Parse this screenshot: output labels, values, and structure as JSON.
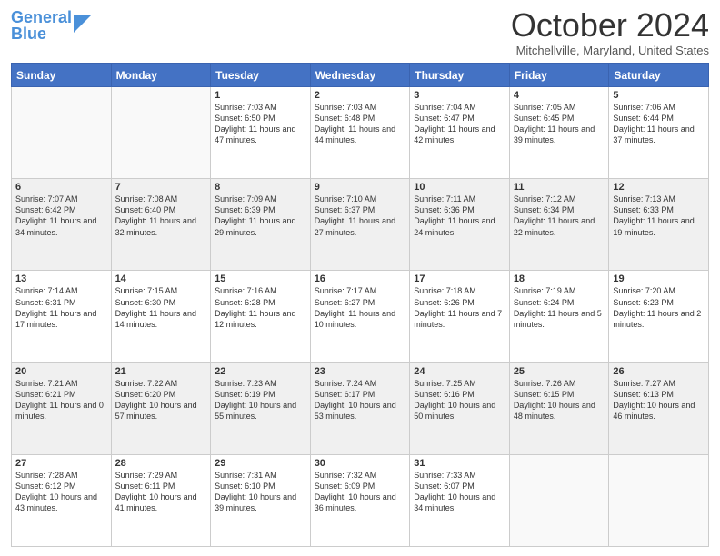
{
  "logo": {
    "line1": "General",
    "line2": "Blue"
  },
  "title": "October 2024",
  "location": "Mitchellville, Maryland, United States",
  "days_header": [
    "Sunday",
    "Monday",
    "Tuesday",
    "Wednesday",
    "Thursday",
    "Friday",
    "Saturday"
  ],
  "weeks": [
    [
      {
        "day": "",
        "info": ""
      },
      {
        "day": "",
        "info": ""
      },
      {
        "day": "1",
        "info": "Sunrise: 7:03 AM\nSunset: 6:50 PM\nDaylight: 11 hours and 47 minutes."
      },
      {
        "day": "2",
        "info": "Sunrise: 7:03 AM\nSunset: 6:48 PM\nDaylight: 11 hours and 44 minutes."
      },
      {
        "day": "3",
        "info": "Sunrise: 7:04 AM\nSunset: 6:47 PM\nDaylight: 11 hours and 42 minutes."
      },
      {
        "day": "4",
        "info": "Sunrise: 7:05 AM\nSunset: 6:45 PM\nDaylight: 11 hours and 39 minutes."
      },
      {
        "day": "5",
        "info": "Sunrise: 7:06 AM\nSunset: 6:44 PM\nDaylight: 11 hours and 37 minutes."
      }
    ],
    [
      {
        "day": "6",
        "info": "Sunrise: 7:07 AM\nSunset: 6:42 PM\nDaylight: 11 hours and 34 minutes."
      },
      {
        "day": "7",
        "info": "Sunrise: 7:08 AM\nSunset: 6:40 PM\nDaylight: 11 hours and 32 minutes."
      },
      {
        "day": "8",
        "info": "Sunrise: 7:09 AM\nSunset: 6:39 PM\nDaylight: 11 hours and 29 minutes."
      },
      {
        "day": "9",
        "info": "Sunrise: 7:10 AM\nSunset: 6:37 PM\nDaylight: 11 hours and 27 minutes."
      },
      {
        "day": "10",
        "info": "Sunrise: 7:11 AM\nSunset: 6:36 PM\nDaylight: 11 hours and 24 minutes."
      },
      {
        "day": "11",
        "info": "Sunrise: 7:12 AM\nSunset: 6:34 PM\nDaylight: 11 hours and 22 minutes."
      },
      {
        "day": "12",
        "info": "Sunrise: 7:13 AM\nSunset: 6:33 PM\nDaylight: 11 hours and 19 minutes."
      }
    ],
    [
      {
        "day": "13",
        "info": "Sunrise: 7:14 AM\nSunset: 6:31 PM\nDaylight: 11 hours and 17 minutes."
      },
      {
        "day": "14",
        "info": "Sunrise: 7:15 AM\nSunset: 6:30 PM\nDaylight: 11 hours and 14 minutes."
      },
      {
        "day": "15",
        "info": "Sunrise: 7:16 AM\nSunset: 6:28 PM\nDaylight: 11 hours and 12 minutes."
      },
      {
        "day": "16",
        "info": "Sunrise: 7:17 AM\nSunset: 6:27 PM\nDaylight: 11 hours and 10 minutes."
      },
      {
        "day": "17",
        "info": "Sunrise: 7:18 AM\nSunset: 6:26 PM\nDaylight: 11 hours and 7 minutes."
      },
      {
        "day": "18",
        "info": "Sunrise: 7:19 AM\nSunset: 6:24 PM\nDaylight: 11 hours and 5 minutes."
      },
      {
        "day": "19",
        "info": "Sunrise: 7:20 AM\nSunset: 6:23 PM\nDaylight: 11 hours and 2 minutes."
      }
    ],
    [
      {
        "day": "20",
        "info": "Sunrise: 7:21 AM\nSunset: 6:21 PM\nDaylight: 11 hours and 0 minutes."
      },
      {
        "day": "21",
        "info": "Sunrise: 7:22 AM\nSunset: 6:20 PM\nDaylight: 10 hours and 57 minutes."
      },
      {
        "day": "22",
        "info": "Sunrise: 7:23 AM\nSunset: 6:19 PM\nDaylight: 10 hours and 55 minutes."
      },
      {
        "day": "23",
        "info": "Sunrise: 7:24 AM\nSunset: 6:17 PM\nDaylight: 10 hours and 53 minutes."
      },
      {
        "day": "24",
        "info": "Sunrise: 7:25 AM\nSunset: 6:16 PM\nDaylight: 10 hours and 50 minutes."
      },
      {
        "day": "25",
        "info": "Sunrise: 7:26 AM\nSunset: 6:15 PM\nDaylight: 10 hours and 48 minutes."
      },
      {
        "day": "26",
        "info": "Sunrise: 7:27 AM\nSunset: 6:13 PM\nDaylight: 10 hours and 46 minutes."
      }
    ],
    [
      {
        "day": "27",
        "info": "Sunrise: 7:28 AM\nSunset: 6:12 PM\nDaylight: 10 hours and 43 minutes."
      },
      {
        "day": "28",
        "info": "Sunrise: 7:29 AM\nSunset: 6:11 PM\nDaylight: 10 hours and 41 minutes."
      },
      {
        "day": "29",
        "info": "Sunrise: 7:31 AM\nSunset: 6:10 PM\nDaylight: 10 hours and 39 minutes."
      },
      {
        "day": "30",
        "info": "Sunrise: 7:32 AM\nSunset: 6:09 PM\nDaylight: 10 hours and 36 minutes."
      },
      {
        "day": "31",
        "info": "Sunrise: 7:33 AM\nSunset: 6:07 PM\nDaylight: 10 hours and 34 minutes."
      },
      {
        "day": "",
        "info": ""
      },
      {
        "day": "",
        "info": ""
      }
    ]
  ]
}
